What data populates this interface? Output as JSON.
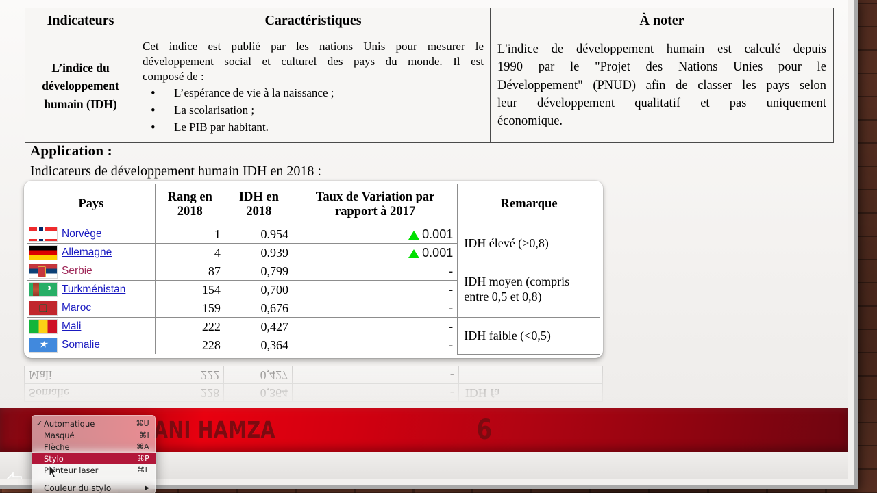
{
  "slide": {
    "table1": {
      "headers": [
        "Indicateurs",
        "Caractéristiques",
        "À noter"
      ],
      "indicator": "L’indice du développement humain (IDH)",
      "caracteristiques": {
        "intro_line1": "Cet indice est publié par les nations Unis pour mesurer le",
        "intro_line2": "développement social et culturel des pays du monde. Il est",
        "intro_line3": "composé de :",
        "bullets": [
          "L’espérance de vie à la naissance ;",
          "La scolarisation ;",
          "Le PIB par habitant."
        ]
      },
      "a_noter": {
        "line1": "L'indice de développement humain est calculé depuis",
        "line2": "1990 par le \"Projet des Nations Unies pour le",
        "line3": "Développement\" (PNUD) afin de classer les pays selon",
        "line4": "leur développement qualitatif et pas uniquement",
        "line5": "économique."
      }
    },
    "application": {
      "title": "Application :",
      "subtitle": "Indicateurs de développement humain IDH en 2018 :"
    },
    "table2": {
      "headers": {
        "pays": "Pays",
        "rang": "Rang en 2018",
        "idh": "IDH en 2018",
        "variation": "Taux de Variation par rapport à 2017",
        "remarque": "Remarque"
      },
      "rows": [
        {
          "flag": "norway-flag",
          "country": "Norvège",
          "link_state": "normal",
          "rang": "1",
          "idh": "0.954",
          "variation": "0.001",
          "variation_trend": "up"
        },
        {
          "flag": "germany-flag",
          "country": "Allemagne",
          "link_state": "normal",
          "rang": "4",
          "idh": "0.939",
          "variation": "0.001",
          "variation_trend": "up"
        },
        {
          "flag": "serbia-flag",
          "country": "Serbie",
          "link_state": "visited",
          "rang": "87",
          "idh": "0,799",
          "variation": "-",
          "variation_trend": "none"
        },
        {
          "flag": "turkmenistan-flag",
          "country": "Turkménistan",
          "link_state": "normal",
          "rang": "154",
          "idh": "0,700",
          "variation": "-",
          "variation_trend": "none"
        },
        {
          "flag": "morocco-flag",
          "country": "Maroc",
          "link_state": "normal",
          "rang": "159",
          "idh": "0,676",
          "variation": "-",
          "variation_trend": "none"
        },
        {
          "flag": "mali-flag",
          "country": "Mali",
          "link_state": "normal",
          "rang": "222",
          "idh": "0,427",
          "variation": "-",
          "variation_trend": "none"
        },
        {
          "flag": "somalia-flag",
          "country": "Somalie",
          "link_state": "normal",
          "rang": "228",
          "idh": "0,364",
          "variation": "-",
          "variation_trend": "none"
        }
      ],
      "remarks": [
        {
          "text": "IDH élevé (>0,8)",
          "rowspan": 2
        },
        {
          "text": "IDH moyen (compris entre 0,5 et 0,8)",
          "rowspan": 3
        },
        {
          "text": "IDH faible (<0,5)",
          "rowspan": 2
        }
      ]
    },
    "reflection": {
      "rows": [
        {
          "country": "Somalie",
          "rang": "228",
          "idh": "0,364",
          "variation": "-",
          "remarque": "IDH fa"
        },
        {
          "country": "Mali",
          "rang": "222",
          "idh": "0,427",
          "variation": "-",
          "remarque": ""
        }
      ]
    },
    "banner": {
      "author": "ANI HAMZA",
      "page_number": "6"
    }
  },
  "context_menu": {
    "items": [
      {
        "label": "Automatique",
        "shortcut": "⌘U",
        "checked": true,
        "selected": false
      },
      {
        "label": "Masqué",
        "shortcut": "⌘I",
        "checked": false,
        "selected": false
      },
      {
        "label": "Flèche",
        "shortcut": "⌘A",
        "checked": false,
        "selected": false
      },
      {
        "label": "Stylo",
        "shortcut": "⌘P",
        "checked": false,
        "selected": true
      },
      {
        "label": "Pointeur laser",
        "shortcut": "⌘L",
        "checked": false,
        "selected": false
      }
    ],
    "submenu_items": [
      {
        "label": "Couleur du stylo",
        "arrow": "▶"
      }
    ]
  },
  "nav": {
    "back_icon": "back-arrow-icon",
    "pen_icon": "pen-icon"
  },
  "colors": {
    "banner_red": "#d10010",
    "link_blue": "#1a1ac0",
    "link_visited": "#a02a5a",
    "variation_green": "#00e000",
    "menu_highlight": "#b2173a"
  }
}
